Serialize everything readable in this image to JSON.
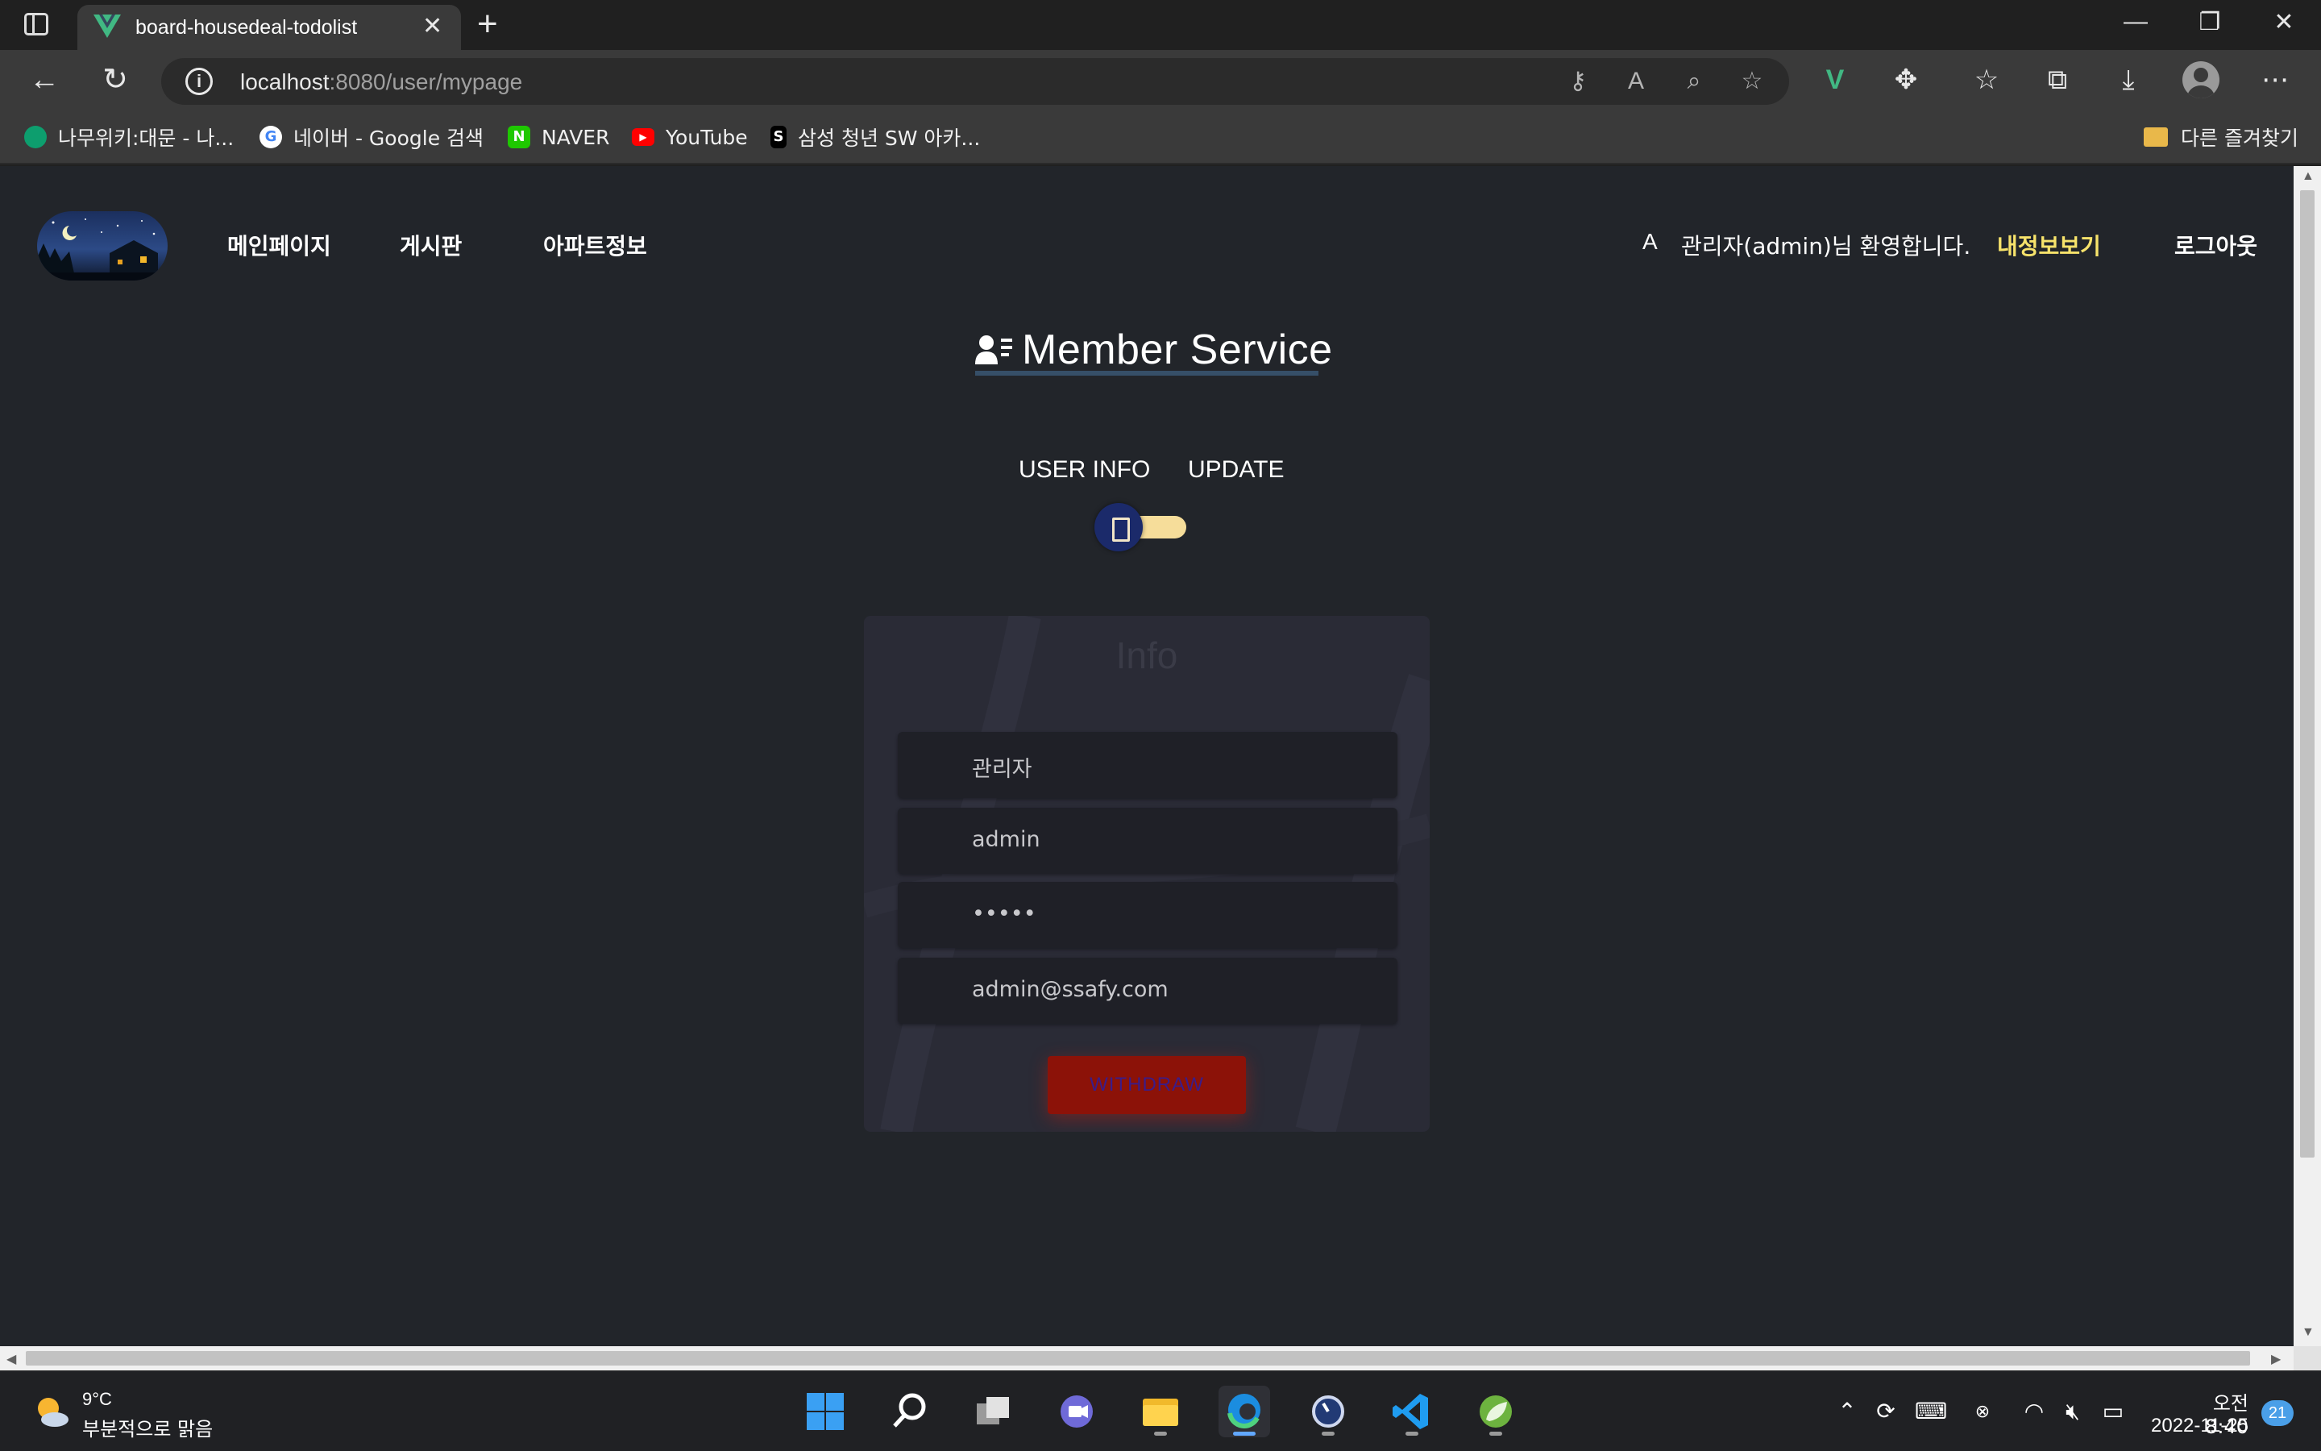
{
  "browser": {
    "tab_title": "board-housedeal-todolist",
    "url_host": "localhost",
    "url_path": ":8080/user/mypage",
    "accent": "#41b883"
  },
  "bookmarks": [
    {
      "label": "나무위키:대문 - 나...",
      "icon": "namuwiki-icon",
      "color": "#0d9e6e"
    },
    {
      "label": "네이버 - Google 검색",
      "icon": "google-icon",
      "color": "#ffffff"
    },
    {
      "label": "NAVER",
      "icon": "naver-icon",
      "color": "#1ec800"
    },
    {
      "label": "YouTube",
      "icon": "youtube-icon",
      "color": "#ff0000"
    },
    {
      "label": "삼성 청년 SW 아카...",
      "icon": "ssafy-icon",
      "color": "#000000"
    }
  ],
  "other_bookmarks": "다른 즐겨찾기",
  "site": {
    "menu": [
      "메인페이지",
      "게시판",
      "아파트정보"
    ],
    "welcome_icon_text": "A",
    "welcome_text": "관리자(admin)님 환영합니다.",
    "mypage_link": "내정보보기",
    "logout_link": "로그아웃",
    "mypage_color": "#f7e36b"
  },
  "main": {
    "title": "Member Service",
    "toggle_left": "USER INFO",
    "toggle_right": "UPDATE",
    "card": {
      "title": "Info",
      "fields": [
        "관리자",
        "admin",
        "•••••",
        "admin@ssafy.com"
      ],
      "withdraw_label": "WITHDRAW"
    }
  },
  "taskbar": {
    "weather_temp": "9°C",
    "weather_desc": "부분적으로 맑음",
    "time": "오전 8:40",
    "date": "2022-11-25",
    "notifications": "21"
  }
}
